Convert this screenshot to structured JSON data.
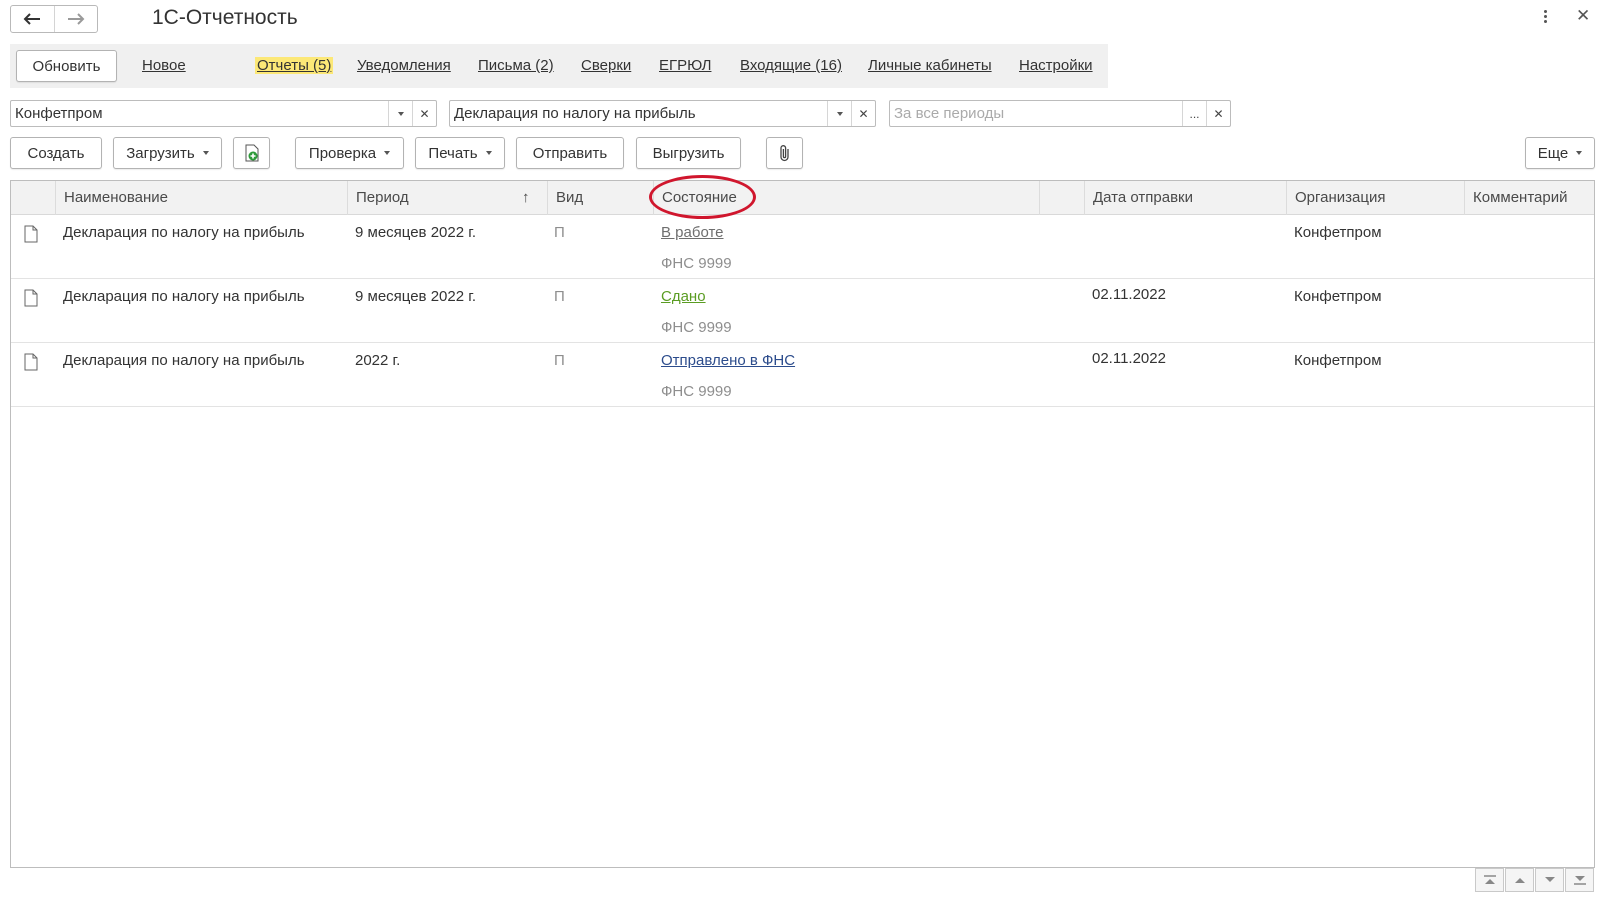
{
  "app": {
    "title": "1С-Отчетность"
  },
  "nav": {
    "refresh": "Обновить",
    "links": [
      "Новое",
      "Отчеты (5)",
      "Уведомления",
      "Письма (2)",
      "Сверки",
      "ЕГРЮЛ",
      "Входящие (16)",
      "Личные кабинеты",
      "Настройки"
    ],
    "active": "Отчеты (5)"
  },
  "filters": {
    "organization": "Конфетпром",
    "report_type": "Декларация по налогу на прибыль",
    "period_placeholder": "За все периоды",
    "period_picker": "..."
  },
  "toolbar": {
    "create": "Создать",
    "load": "Загрузить",
    "check": "Проверка",
    "print": "Печать",
    "send": "Отправить",
    "export": "Выгрузить",
    "more": "Еще"
  },
  "table": {
    "columns": {
      "name": "Наименование",
      "period": "Период",
      "sort_indicator": "↑",
      "kind": "Вид",
      "status": "Состояние",
      "sent_date": "Дата отправки",
      "organization": "Организация",
      "comment": "Комментарий"
    },
    "rows": [
      {
        "name": "Декларация по налогу на прибыль",
        "period": "9 месяцев 2022 г.",
        "kind": "П",
        "status": "В работе",
        "status_color": "#6e6e6e",
        "authority": "ФНС 9999",
        "sent_date": "",
        "organization": "Конфетпром",
        "comment": ""
      },
      {
        "name": "Декларация по налогу на прибыль",
        "period": "9 месяцев 2022 г.",
        "kind": "П",
        "status": "Сдано",
        "status_color": "#5a9c22",
        "authority": "ФНС 9999",
        "sent_date": "02.11.2022",
        "organization": "Конфетпром",
        "comment": ""
      },
      {
        "name": "Декларация по налогу на прибыль",
        "period": "2022 г.",
        "kind": "П",
        "status": "Отправлено в ФНС",
        "status_color": "#2c4c8c",
        "authority": "ФНС 9999",
        "sent_date": "02.11.2022",
        "organization": "Конфетпром",
        "comment": ""
      }
    ]
  },
  "colors": {
    "active_tab_highlight": "#fce877",
    "annotation_circle": "#d0162d"
  }
}
